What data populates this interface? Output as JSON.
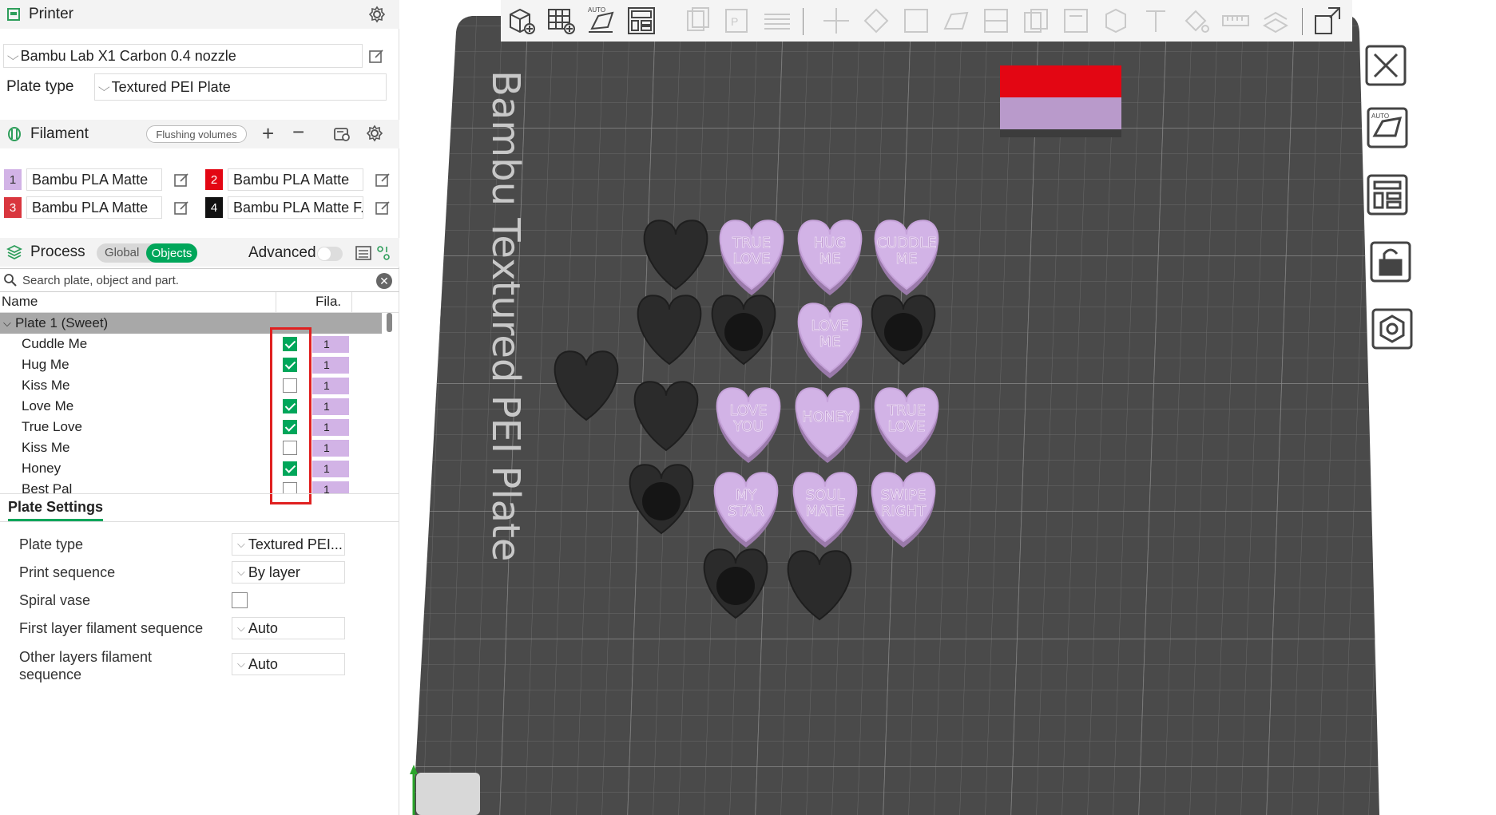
{
  "printer": {
    "section_title": "Printer",
    "preset": "Bambu Lab X1 Carbon 0.4 nozzle",
    "plate_type_label": "Plate type",
    "plate_type_value": "Textured PEI Plate"
  },
  "filament": {
    "section_title": "Filament",
    "flushing_label": "Flushing volumes",
    "items": [
      {
        "num": "1",
        "name": "Bambu PLA Matte",
        "color": "#d2b3e6",
        "num_color": "#333"
      },
      {
        "num": "2",
        "name": "Bambu PLA Matte",
        "color": "#e30613",
        "num_color": "#fff"
      },
      {
        "num": "3",
        "name": "Bambu PLA Matte",
        "color": "#d9363e",
        "num_color": "#fff"
      },
      {
        "num": "4",
        "name": "Bambu PLA Matte F...",
        "color": "#111111",
        "num_color": "#fff"
      }
    ]
  },
  "process": {
    "section_title": "Process",
    "toggle_global": "Global",
    "toggle_objects": "Objects",
    "advanced_label": "Advanced"
  },
  "search": {
    "placeholder": "Search plate, object and part."
  },
  "object_list": {
    "col_name": "Name",
    "col_fila": "Fila.",
    "plate_label": "Plate 1 (Sweet)",
    "rows": [
      {
        "name": "Cuddle Me",
        "checked": true,
        "fila": "1"
      },
      {
        "name": "Hug Me",
        "checked": true,
        "fila": "1"
      },
      {
        "name": "Kiss Me",
        "checked": false,
        "fila": "1"
      },
      {
        "name": "Love Me",
        "checked": true,
        "fila": "1"
      },
      {
        "name": "True Love",
        "checked": true,
        "fila": "1"
      },
      {
        "name": "Kiss Me",
        "checked": false,
        "fila": "1"
      },
      {
        "name": "Honey",
        "checked": true,
        "fila": "1"
      },
      {
        "name": "Best Pal",
        "checked": false,
        "fila": "1"
      }
    ]
  },
  "plate_settings": {
    "tab_label": "Plate Settings",
    "plate_type_label": "Plate type",
    "plate_type_value": "Textured PEI...",
    "print_sequence_label": "Print sequence",
    "print_sequence_value": "By layer",
    "spiral_vase_label": "Spiral vase",
    "first_layer_label": "First layer filament sequence",
    "first_layer_value": "Auto",
    "other_layers_label": "Other layers filament sequence",
    "other_layers_value": "Auto"
  },
  "viewport": {
    "bed_label": "Bambu Textured PEI Plate",
    "bed_color": "#4a4a4a",
    "heart_text_color": "#b993cc",
    "pink_hearts": [
      {
        "text": "TRUE\nLOVE"
      },
      {
        "text": "HUG\nME"
      },
      {
        "text": "CUDDLE\nME"
      },
      {
        "text": "LOVE\nME"
      },
      {
        "text": "LOVE\nYOU"
      },
      {
        "text": "HONEY"
      },
      {
        "text": "TRUE\nLOVE"
      },
      {
        "text": "MY\nSTAR"
      },
      {
        "text": "SOUL\nMATE"
      },
      {
        "text": "SWIPE\nRIGHT"
      }
    ]
  },
  "colors": {
    "accent": "#00a65a",
    "highlight": "#e02020",
    "pink": "#d2b3e6"
  }
}
